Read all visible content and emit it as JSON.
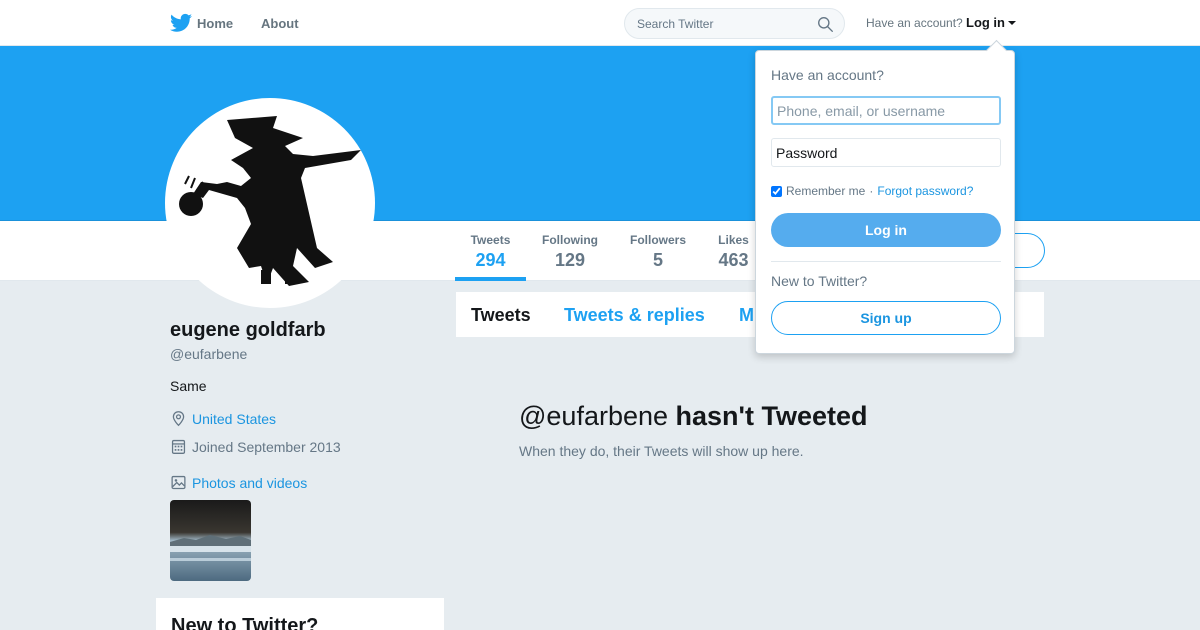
{
  "nav": {
    "home_label": "Home",
    "about_label": "About",
    "search_placeholder": "Search Twitter",
    "account_hint": "Have an account?",
    "login_label": "Log in"
  },
  "profile": {
    "name": "eugene goldfarb",
    "handle": "@eufarbene",
    "bio": "Same",
    "location": "United States",
    "joined": "Joined September 2013",
    "photos_label": "Photos and videos"
  },
  "stats": [
    {
      "label": "Tweets",
      "value": "294"
    },
    {
      "label": "Following",
      "value": "129"
    },
    {
      "label": "Followers",
      "value": "5"
    },
    {
      "label": "Likes",
      "value": "463"
    }
  ],
  "tabs": [
    "Tweets",
    "Tweets & replies",
    "M"
  ],
  "empty_state": {
    "handle": "@eufarbene",
    "title_rest": "hasn't Tweeted",
    "subtitle": "When they do, their Tweets will show up here."
  },
  "sidebar_card": {
    "title": "New to Twitter?"
  },
  "login_dropdown": {
    "heading": "Have an account?",
    "username_placeholder": "Phone, email, or username",
    "password_placeholder": "Password",
    "remember_label": "Remember me",
    "separator": "·",
    "forgot_label": "Forgot password?",
    "login_button": "Log in",
    "new_prompt": "New to Twitter?",
    "signup_button": "Sign up"
  },
  "colors": {
    "brand_blue": "#1da1f2",
    "link_blue": "#1b95e0",
    "background": "#e6ecf0",
    "muted_text": "#657786"
  },
  "icons": [
    "twitter-bird-icon",
    "search-icon",
    "location-pin-icon",
    "calendar-icon",
    "photo-icon",
    "chevron-down-icon"
  ]
}
